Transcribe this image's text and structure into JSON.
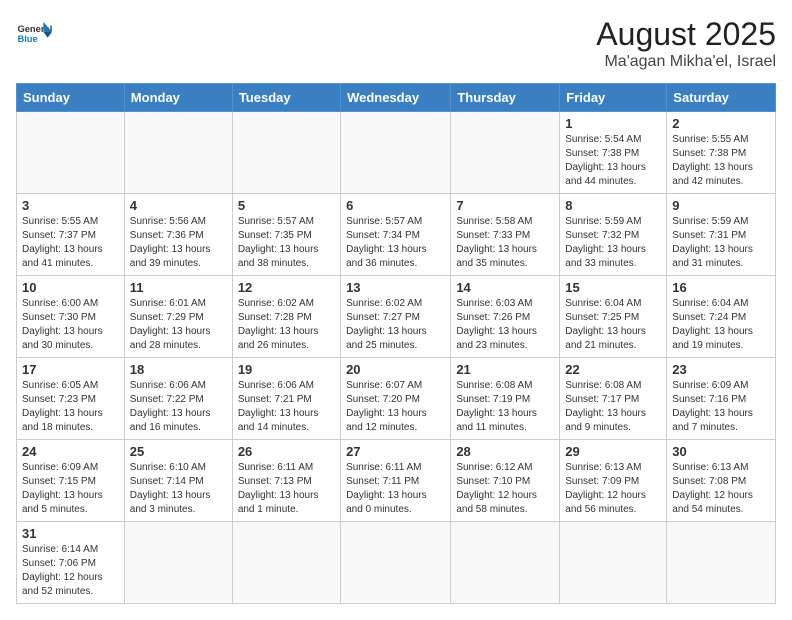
{
  "logo": {
    "text_general": "General",
    "text_blue": "Blue"
  },
  "header": {
    "title": "August 2025",
    "subtitle": "Ma'agan Mikha'el, Israel"
  },
  "days_of_week": [
    "Sunday",
    "Monday",
    "Tuesday",
    "Wednesday",
    "Thursday",
    "Friday",
    "Saturday"
  ],
  "weeks": [
    [
      {
        "day": "",
        "info": ""
      },
      {
        "day": "",
        "info": ""
      },
      {
        "day": "",
        "info": ""
      },
      {
        "day": "",
        "info": ""
      },
      {
        "day": "",
        "info": ""
      },
      {
        "day": "1",
        "info": "Sunrise: 5:54 AM\nSunset: 7:38 PM\nDaylight: 13 hours and 44 minutes."
      },
      {
        "day": "2",
        "info": "Sunrise: 5:55 AM\nSunset: 7:38 PM\nDaylight: 13 hours and 42 minutes."
      }
    ],
    [
      {
        "day": "3",
        "info": "Sunrise: 5:55 AM\nSunset: 7:37 PM\nDaylight: 13 hours and 41 minutes."
      },
      {
        "day": "4",
        "info": "Sunrise: 5:56 AM\nSunset: 7:36 PM\nDaylight: 13 hours and 39 minutes."
      },
      {
        "day": "5",
        "info": "Sunrise: 5:57 AM\nSunset: 7:35 PM\nDaylight: 13 hours and 38 minutes."
      },
      {
        "day": "6",
        "info": "Sunrise: 5:57 AM\nSunset: 7:34 PM\nDaylight: 13 hours and 36 minutes."
      },
      {
        "day": "7",
        "info": "Sunrise: 5:58 AM\nSunset: 7:33 PM\nDaylight: 13 hours and 35 minutes."
      },
      {
        "day": "8",
        "info": "Sunrise: 5:59 AM\nSunset: 7:32 PM\nDaylight: 13 hours and 33 minutes."
      },
      {
        "day": "9",
        "info": "Sunrise: 5:59 AM\nSunset: 7:31 PM\nDaylight: 13 hours and 31 minutes."
      }
    ],
    [
      {
        "day": "10",
        "info": "Sunrise: 6:00 AM\nSunset: 7:30 PM\nDaylight: 13 hours and 30 minutes."
      },
      {
        "day": "11",
        "info": "Sunrise: 6:01 AM\nSunset: 7:29 PM\nDaylight: 13 hours and 28 minutes."
      },
      {
        "day": "12",
        "info": "Sunrise: 6:02 AM\nSunset: 7:28 PM\nDaylight: 13 hours and 26 minutes."
      },
      {
        "day": "13",
        "info": "Sunrise: 6:02 AM\nSunset: 7:27 PM\nDaylight: 13 hours and 25 minutes."
      },
      {
        "day": "14",
        "info": "Sunrise: 6:03 AM\nSunset: 7:26 PM\nDaylight: 13 hours and 23 minutes."
      },
      {
        "day": "15",
        "info": "Sunrise: 6:04 AM\nSunset: 7:25 PM\nDaylight: 13 hours and 21 minutes."
      },
      {
        "day": "16",
        "info": "Sunrise: 6:04 AM\nSunset: 7:24 PM\nDaylight: 13 hours and 19 minutes."
      }
    ],
    [
      {
        "day": "17",
        "info": "Sunrise: 6:05 AM\nSunset: 7:23 PM\nDaylight: 13 hours and 18 minutes."
      },
      {
        "day": "18",
        "info": "Sunrise: 6:06 AM\nSunset: 7:22 PM\nDaylight: 13 hours and 16 minutes."
      },
      {
        "day": "19",
        "info": "Sunrise: 6:06 AM\nSunset: 7:21 PM\nDaylight: 13 hours and 14 minutes."
      },
      {
        "day": "20",
        "info": "Sunrise: 6:07 AM\nSunset: 7:20 PM\nDaylight: 13 hours and 12 minutes."
      },
      {
        "day": "21",
        "info": "Sunrise: 6:08 AM\nSunset: 7:19 PM\nDaylight: 13 hours and 11 minutes."
      },
      {
        "day": "22",
        "info": "Sunrise: 6:08 AM\nSunset: 7:17 PM\nDaylight: 13 hours and 9 minutes."
      },
      {
        "day": "23",
        "info": "Sunrise: 6:09 AM\nSunset: 7:16 PM\nDaylight: 13 hours and 7 minutes."
      }
    ],
    [
      {
        "day": "24",
        "info": "Sunrise: 6:09 AM\nSunset: 7:15 PM\nDaylight: 13 hours and 5 minutes."
      },
      {
        "day": "25",
        "info": "Sunrise: 6:10 AM\nSunset: 7:14 PM\nDaylight: 13 hours and 3 minutes."
      },
      {
        "day": "26",
        "info": "Sunrise: 6:11 AM\nSunset: 7:13 PM\nDaylight: 13 hours and 1 minute."
      },
      {
        "day": "27",
        "info": "Sunrise: 6:11 AM\nSunset: 7:11 PM\nDaylight: 13 hours and 0 minutes."
      },
      {
        "day": "28",
        "info": "Sunrise: 6:12 AM\nSunset: 7:10 PM\nDaylight: 12 hours and 58 minutes."
      },
      {
        "day": "29",
        "info": "Sunrise: 6:13 AM\nSunset: 7:09 PM\nDaylight: 12 hours and 56 minutes."
      },
      {
        "day": "30",
        "info": "Sunrise: 6:13 AM\nSunset: 7:08 PM\nDaylight: 12 hours and 54 minutes."
      }
    ],
    [
      {
        "day": "31",
        "info": "Sunrise: 6:14 AM\nSunset: 7:06 PM\nDaylight: 12 hours and 52 minutes."
      },
      {
        "day": "",
        "info": ""
      },
      {
        "day": "",
        "info": ""
      },
      {
        "day": "",
        "info": ""
      },
      {
        "day": "",
        "info": ""
      },
      {
        "day": "",
        "info": ""
      },
      {
        "day": "",
        "info": ""
      }
    ]
  ]
}
